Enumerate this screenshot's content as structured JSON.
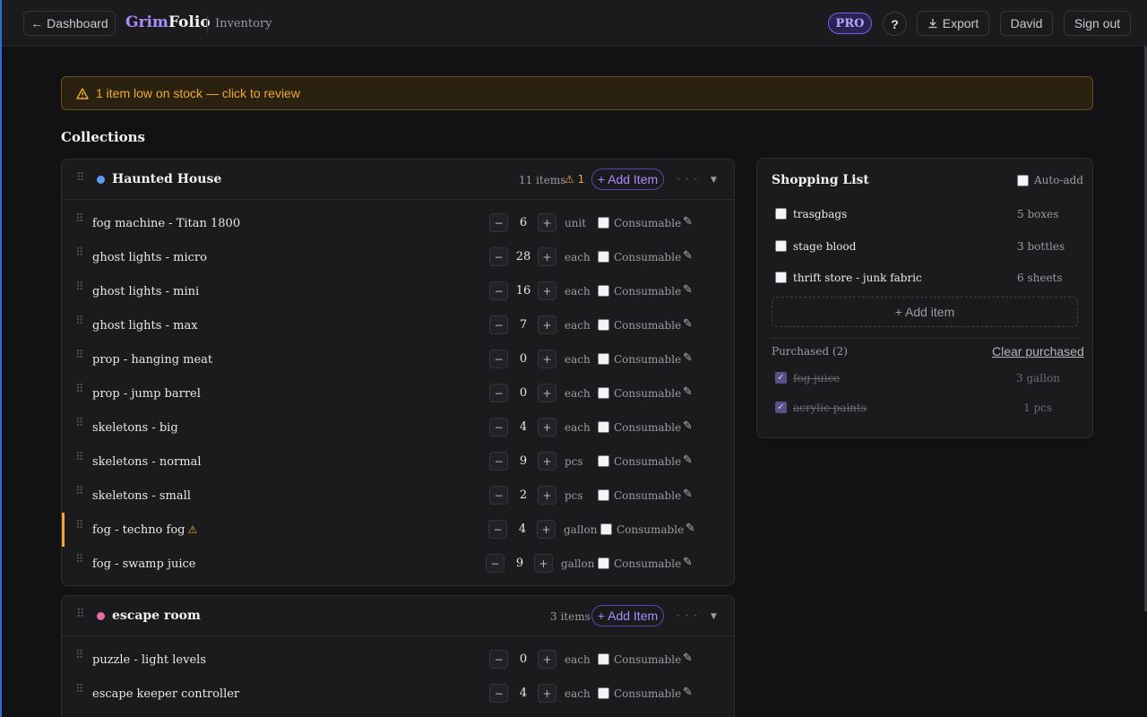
{
  "header": {
    "back_label": "← Dashboard",
    "brand_part1": "Grim",
    "brand_part2": "Folio",
    "section": "Inventory",
    "pro": "PRO",
    "help": "?",
    "export": "Export",
    "user": "David",
    "signout": "Sign out"
  },
  "alert": {
    "icon": "warning-icon",
    "text": "1 item low on stock — click to review",
    "color": "#f0a830"
  },
  "collections_title": "Collections",
  "consumable_label": "Consumable",
  "collections": [
    {
      "name": "Haunted House",
      "color": "#5b9cf0",
      "count": "11 items",
      "low": "1",
      "add": "+ Add Item",
      "items": [
        {
          "name": "fog machine - Titan 1800",
          "qty": "6",
          "unit": "unit"
        },
        {
          "name": "ghost lights - micro",
          "qty": "28",
          "unit": "each"
        },
        {
          "name": "ghost lights - mini",
          "qty": "16",
          "unit": "each"
        },
        {
          "name": "ghost lights - max",
          "qty": "7",
          "unit": "each"
        },
        {
          "name": "prop - hanging meat",
          "qty": "0",
          "unit": "each"
        },
        {
          "name": "prop - jump barrel",
          "qty": "0",
          "unit": "each"
        },
        {
          "name": "skeletons - big",
          "qty": "4",
          "unit": "each"
        },
        {
          "name": "skeletons - normal",
          "qty": "9",
          "unit": "pcs"
        },
        {
          "name": "skeletons - small",
          "qty": "2",
          "unit": "pcs"
        },
        {
          "name": "fog - techno fog",
          "qty": "4",
          "unit": "gallon",
          "low": true
        },
        {
          "name": "fog - swamp juice",
          "qty": "9",
          "unit": "gallon"
        }
      ]
    },
    {
      "name": "escape room",
      "color": "#e86aa8",
      "count": "3 items",
      "add": "+ Add Item",
      "items": [
        {
          "name": "puzzle - light levels",
          "qty": "0",
          "unit": "each"
        },
        {
          "name": "escape keeper controller",
          "qty": "4",
          "unit": "each"
        }
      ]
    }
  ],
  "shopping": {
    "title": "Shopping List",
    "auto_add": "Auto-add",
    "items": [
      {
        "name": "trasgbags",
        "qty": "5",
        "unit": "boxes"
      },
      {
        "name": "stage blood",
        "qty": "3",
        "unit": "bottles"
      },
      {
        "name": "thrift store - junk fabric",
        "qty": "6",
        "unit": "sheets"
      }
    ],
    "add": "+ Add item",
    "purchased_label": "Purchased (2)",
    "clear": "Clear purchased",
    "purchased": [
      {
        "name": "fog juice",
        "qty": "3",
        "unit": "gallon"
      },
      {
        "name": "acrylic paints",
        "qty": "1",
        "unit": "pcs"
      }
    ]
  }
}
